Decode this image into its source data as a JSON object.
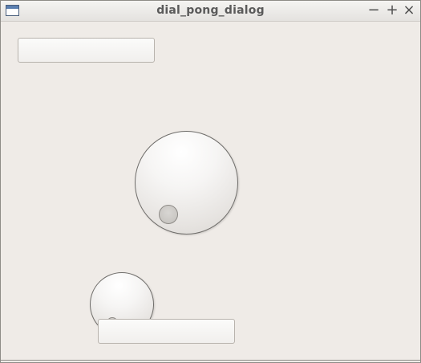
{
  "window": {
    "title": "dial_pong_dialog",
    "controls": {
      "minimize": "−",
      "maximize": "+",
      "close": "×"
    },
    "icon": "window-app-icon"
  },
  "fields": {
    "top": {
      "value": ""
    },
    "bottom": {
      "value": ""
    }
  },
  "dials": {
    "large": {
      "icon": "dial-knob"
    },
    "small": {
      "icon": "dial-knob"
    }
  }
}
